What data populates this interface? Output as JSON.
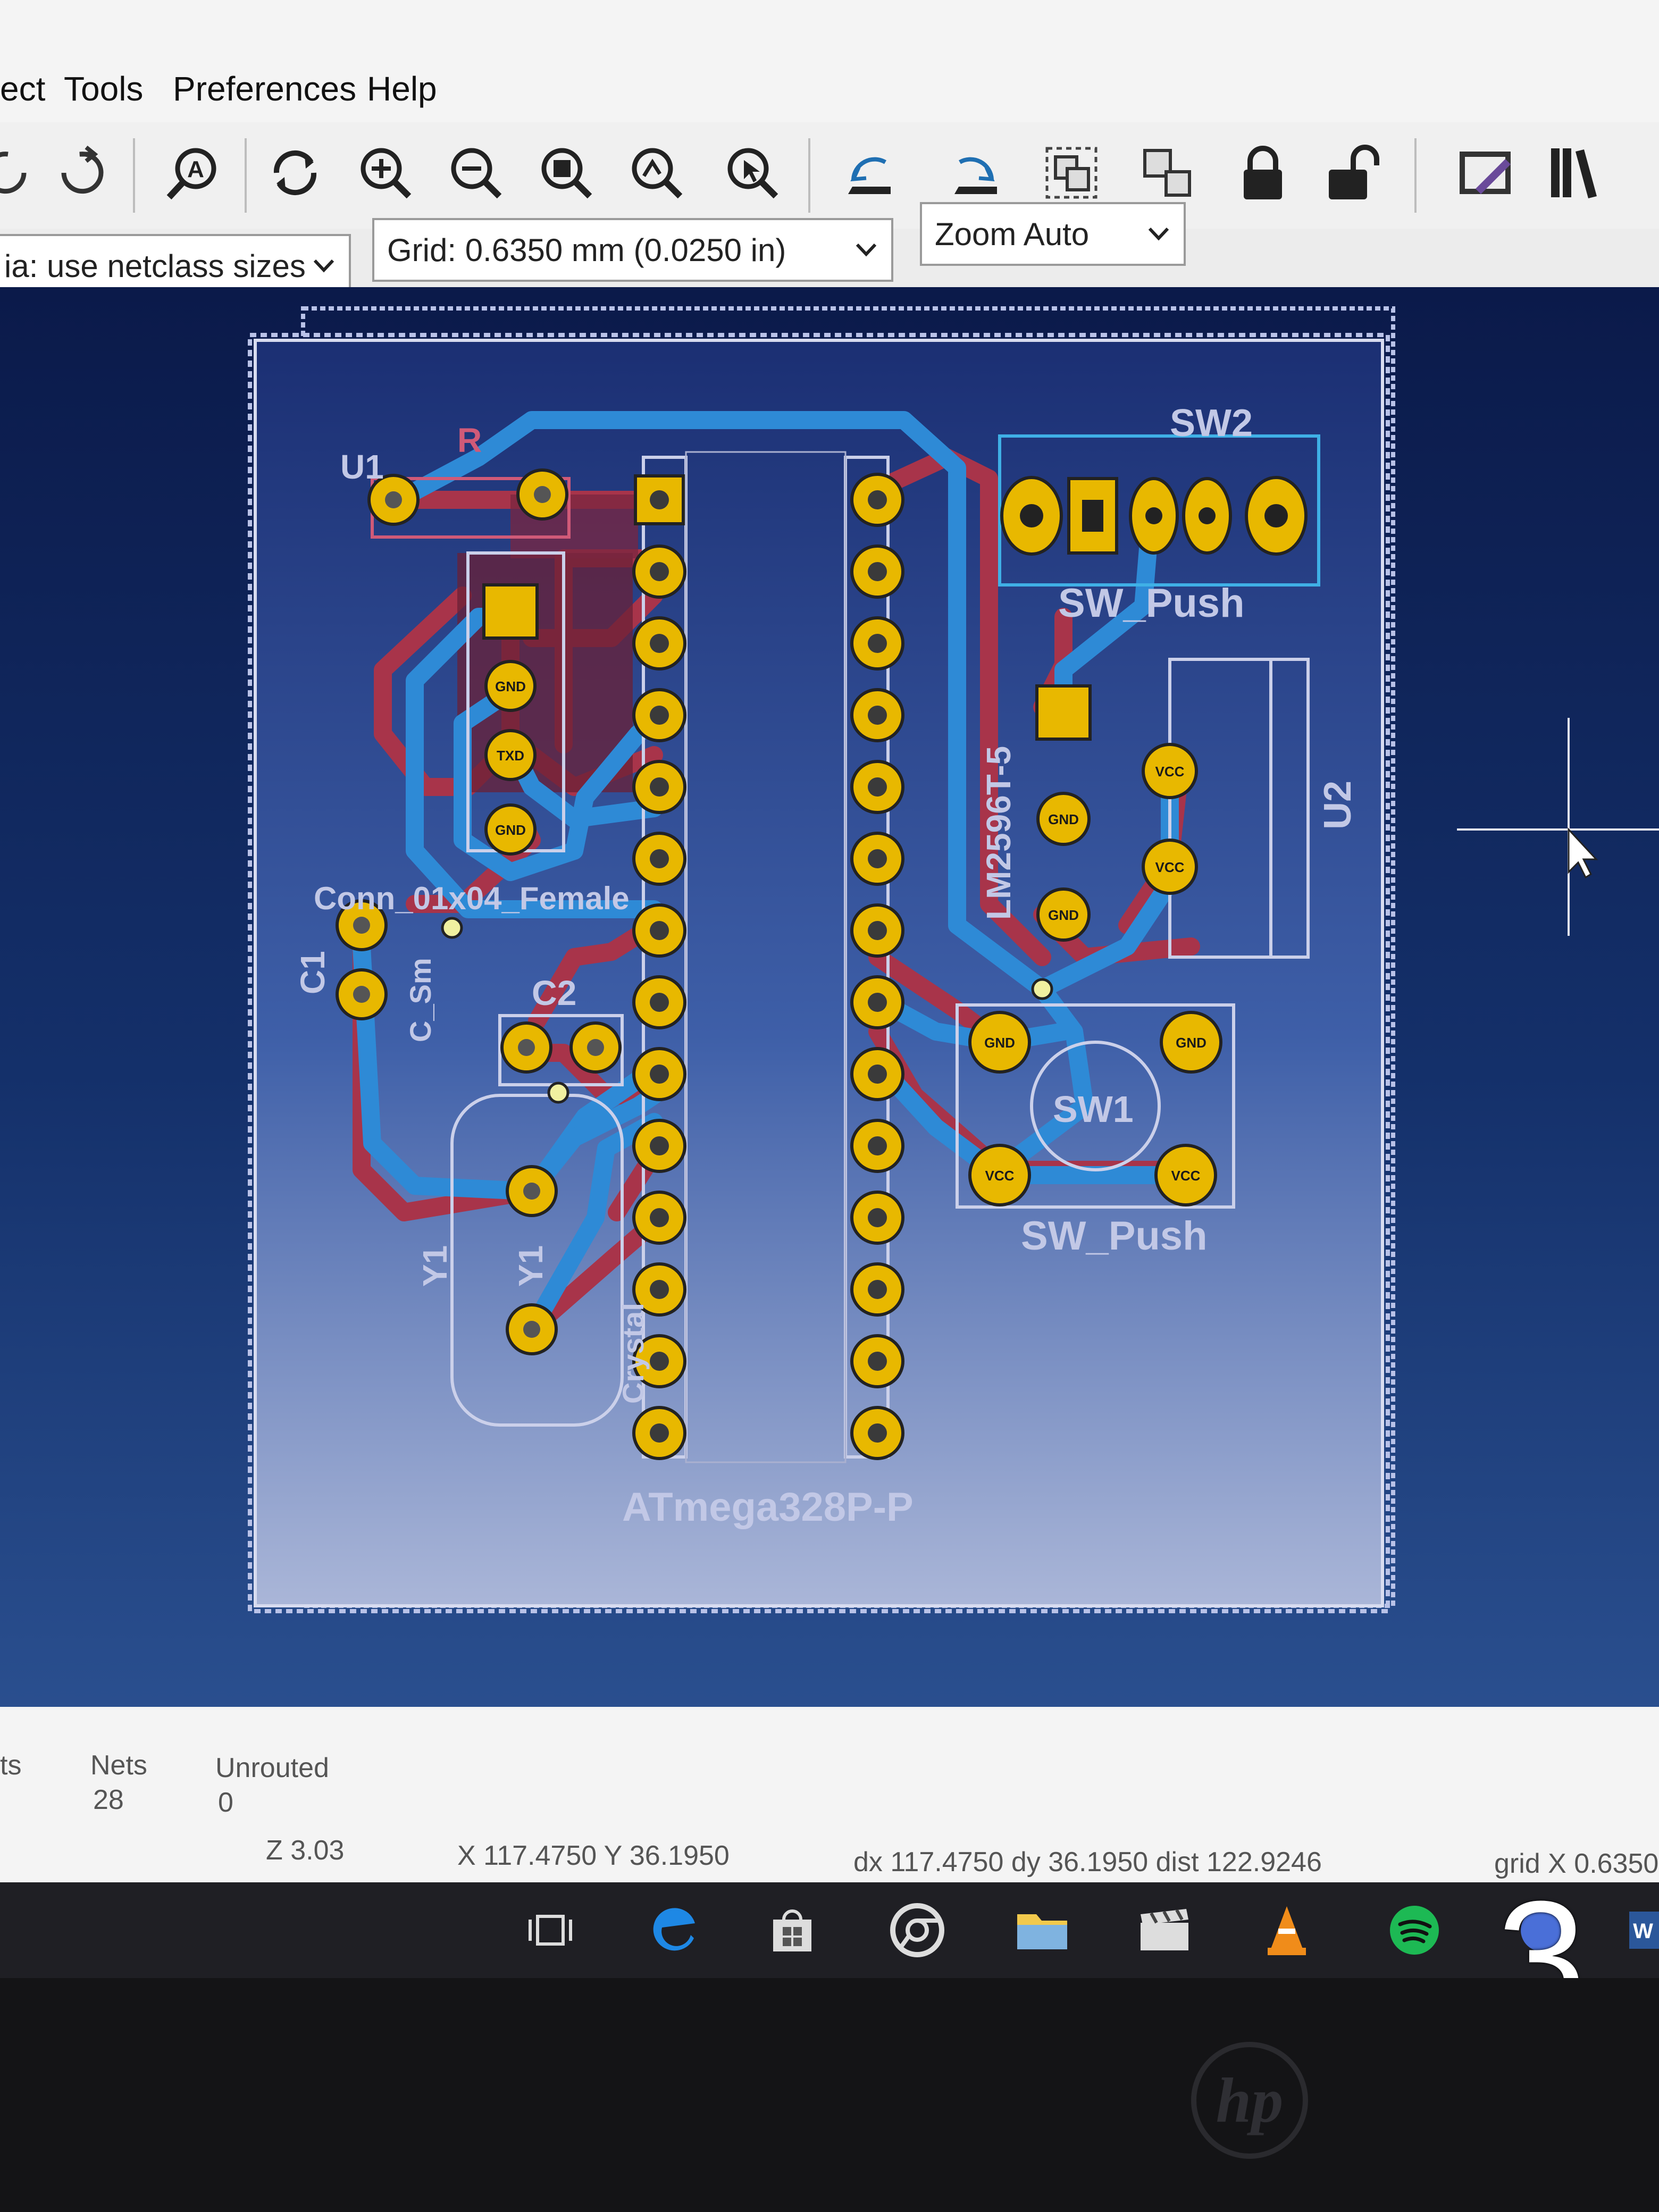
{
  "menubar": {
    "items": [
      "ect",
      "Tools",
      "Preferences",
      "Help"
    ]
  },
  "toolbar": {
    "icons": [
      "undo-icon",
      "redo-icon",
      "find-icon",
      "refresh-icon",
      "zoom-in-icon",
      "zoom-out-icon",
      "zoom-fit-icon",
      "zoom-selection-icon",
      "zoom-tool-icon",
      "rotate-ccw-icon",
      "rotate-cw-icon",
      "group-icon",
      "ungroup-icon",
      "lock-icon",
      "unlock-icon",
      "edit-footprint-icon",
      "library-icon"
    ]
  },
  "selectors": {
    "track_via": "ia: use netclass sizes",
    "grid": "Grid: 0.6350 mm (0.0250 in)",
    "zoom": "Zoom Auto"
  },
  "board_labels": {
    "u1_top": "U1",
    "r_top": "R",
    "sw2": "SW2",
    "sw_push_top": "SW_Push",
    "lm2596": "LM2596T-5",
    "u2": "U2",
    "conn": "Conn_01x04_Female",
    "c1": "C1",
    "c_small": "C_Sm",
    "c2": "C2",
    "sw1": "SW1",
    "sw_push_bottom": "SW_Push",
    "y1_a": "Y1",
    "y1_b": "Y1",
    "crystal": "Crystal",
    "atmega": "ATmega328P-P",
    "pad_vcc": "VCC",
    "pad_gnd": "GND",
    "pad_txd": "TXD"
  },
  "status": {
    "pads_label": "ts",
    "nets_label": "Nets",
    "nets_value": "28",
    "unrouted_label": "Unrouted",
    "unrouted_value": "0",
    "zoom": "Z 3.03",
    "xy": "X 117.4750  Y 36.1950",
    "delta": "dx 117.4750  dy 36.1950  dist 122.9246",
    "grid": "grid X 0.6350"
  },
  "taskbar": {
    "icons": [
      "task-view-icon",
      "edge-icon",
      "store-icon",
      "chrome-icon",
      "file-explorer-icon",
      "movies-icon",
      "vlc-icon",
      "spotify-icon",
      "photos-icon",
      "word-icon"
    ],
    "overlay_number": "3"
  },
  "colors": {
    "board_bg": "#1a2f6e",
    "top_copper": "#c0392b",
    "bottom_copper": "#3a9ad9",
    "pad": "#e8b800",
    "silkscreen": "#c8c8e0"
  }
}
